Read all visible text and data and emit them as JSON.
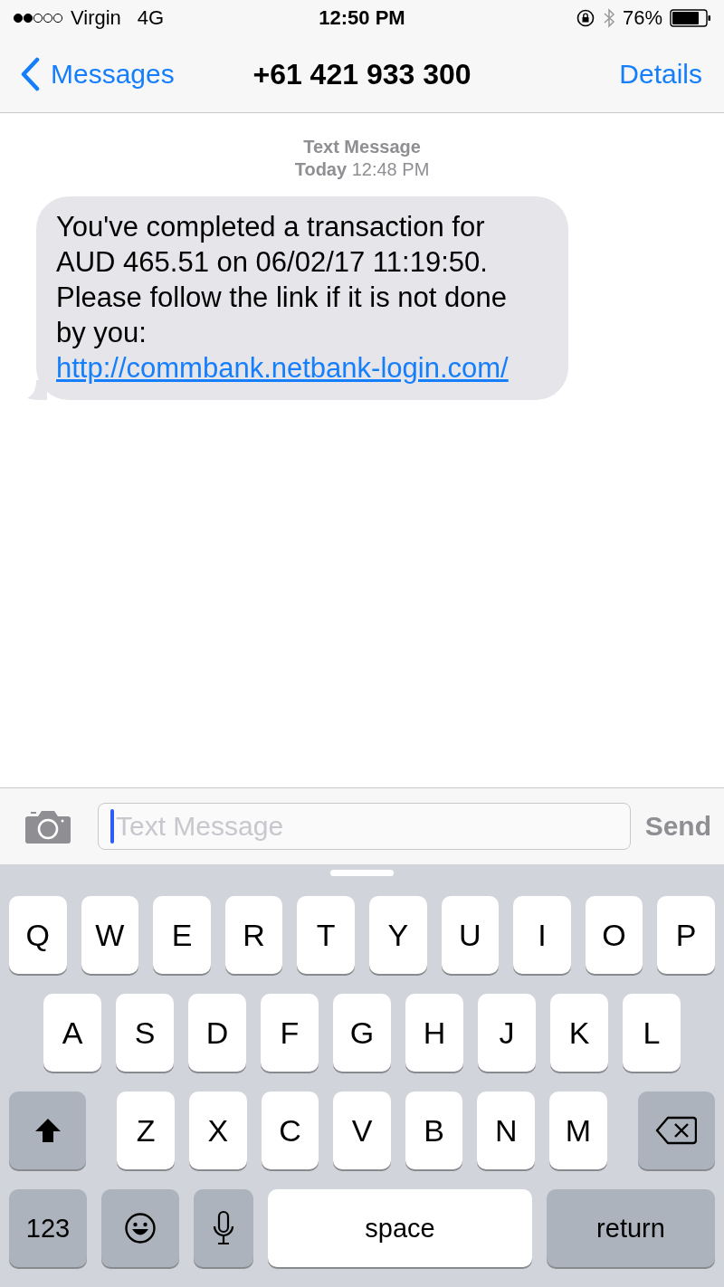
{
  "status_bar": {
    "carrier": "Virgin",
    "network": "4G",
    "time": "12:50 PM",
    "battery": "76%"
  },
  "nav": {
    "back": "Messages",
    "title": "+61 421 933 300",
    "action": "Details"
  },
  "conversation": {
    "header": "Text Message",
    "timestamp": "**Today** 12:48 PM",
    "messages": [
      {
        "text": "You've completed a transaction for AUD 465.51 on 06/02/17 11:19:50. Please follow the link if it is not done by you: ",
        "link": "http://commbank.netbank-login.com/"
      }
    ]
  },
  "composer": {
    "placeholder": "Text Message",
    "send": {
      "label": "Send",
      "disabled": true
    }
  },
  "keyboard": {
    "rows": [
      {
        "keys": [
          {
            "kind": "letter",
            "label": "Q"
          },
          {
            "kind": "letter",
            "label": "W"
          },
          {
            "kind": "letter",
            "label": "E"
          },
          {
            "kind": "letter",
            "label": "R"
          },
          {
            "kind": "letter",
            "label": "T"
          },
          {
            "kind": "letter",
            "label": "Y"
          },
          {
            "kind": "letter",
            "label": "U"
          },
          {
            "kind": "letter",
            "label": "I"
          },
          {
            "kind": "letter",
            "label": "O"
          },
          {
            "kind": "letter",
            "label": "P"
          }
        ]
      },
      {
        "keys": [
          {
            "kind": "letter",
            "label": "A"
          },
          {
            "kind": "letter",
            "label": "S"
          },
          {
            "kind": "letter",
            "label": "D"
          },
          {
            "kind": "letter",
            "label": "F"
          },
          {
            "kind": "letter",
            "label": "G"
          },
          {
            "kind": "letter",
            "label": "H"
          },
          {
            "kind": "letter",
            "label": "J"
          },
          {
            "kind": "letter",
            "label": "K"
          },
          {
            "kind": "letter",
            "label": "L"
          }
        ]
      },
      {
        "keys": [
          {
            "kind": "shift"
          },
          {
            "kind": "letter",
            "label": "Z"
          },
          {
            "kind": "letter",
            "label": "X"
          },
          {
            "kind": "letter",
            "label": "C"
          },
          {
            "kind": "letter",
            "label": "V"
          },
          {
            "kind": "letter",
            "label": "B"
          },
          {
            "kind": "letter",
            "label": "N"
          },
          {
            "kind": "letter",
            "label": "M"
          },
          {
            "kind": "delete"
          }
        ]
      },
      {
        "keys": [
          {
            "kind": "function",
            "label": "123"
          },
          {
            "kind": "emoji"
          },
          {
            "kind": "mic"
          },
          {
            "kind": "space",
            "label": "space"
          },
          {
            "kind": "return",
            "label": "return"
          }
        ]
      }
    ]
  }
}
